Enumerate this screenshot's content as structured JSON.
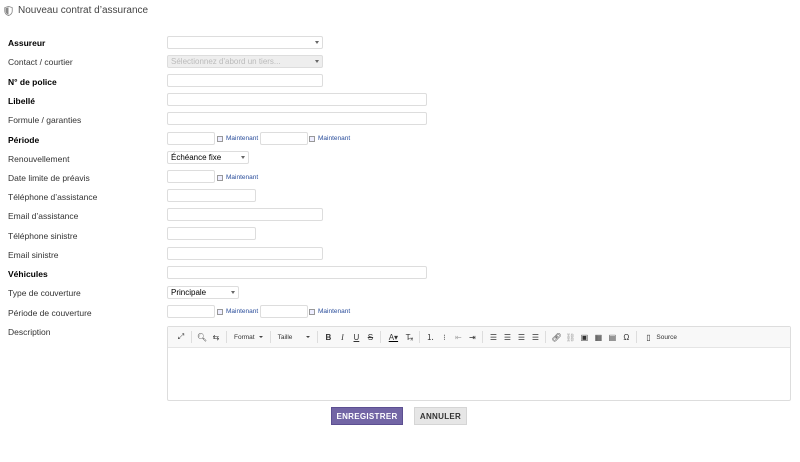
{
  "page": {
    "title": "Nouveau contrat d’assurance"
  },
  "form": {
    "assureur": {
      "label": "Assureur"
    },
    "contact": {
      "label": "Contact / courtier",
      "placeholder": "Sélectionnez d'abord un tiers..."
    },
    "police": {
      "label": "N° de police"
    },
    "libelle": {
      "label": "Libellé"
    },
    "formule": {
      "label": "Formule / garanties"
    },
    "periode": {
      "label": "Période"
    },
    "renouvellement": {
      "label": "Renouvellement",
      "value": "Échéance fixe"
    },
    "preavis": {
      "label": "Date limite de préavis"
    },
    "tel_assistance": {
      "label": "Téléphone d’assistance"
    },
    "email_assistance": {
      "label": "Email d’assistance"
    },
    "tel_sinistre": {
      "label": "Téléphone sinistre"
    },
    "email_sinistre": {
      "label": "Email sinistre"
    },
    "vehicules": {
      "label": "Véhicules"
    },
    "type_couverture": {
      "label": "Type de couverture",
      "value": "Principale"
    },
    "periode_couverture": {
      "label": "Période de couverture"
    },
    "description": {
      "label": "Description"
    },
    "now_label": "Maintenant"
  },
  "editor": {
    "format_label": "Format",
    "size_label": "Taille",
    "source_label": "Source"
  },
  "actions": {
    "save": "ENREGISTRER",
    "cancel": "ANNULER"
  }
}
